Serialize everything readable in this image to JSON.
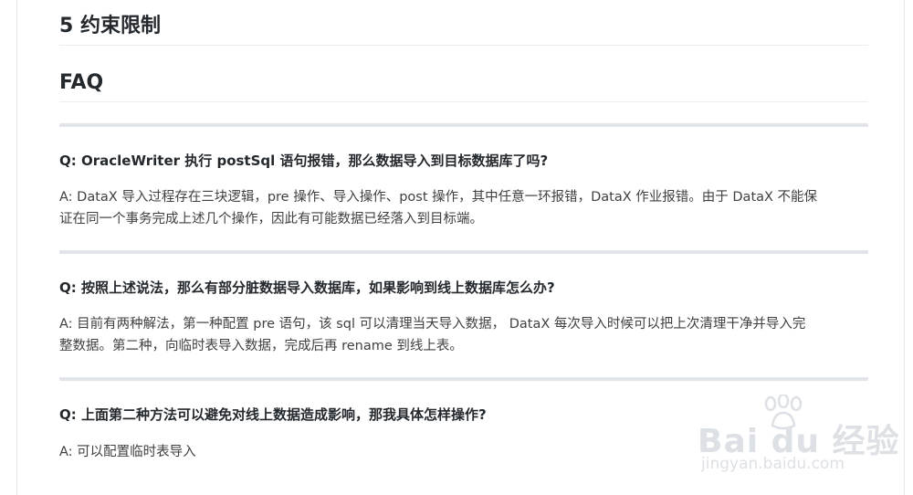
{
  "headings": {
    "constraints": "5 约束限制",
    "faq": "FAQ"
  },
  "faq": [
    {
      "question": "Q: OracleWriter 执行 postSql 语句报错，那么数据导入到目标数据库了吗?",
      "answer_lines": [
        "A: DataX 导入过程存在三块逻辑，pre 操作、导入操作、post 操作，其中任意一环报错，DataX 作业报错。由于 DataX 不能保",
        "证在同一个事务完成上述几个操作，因此有可能数据已经落入到目标端。"
      ]
    },
    {
      "question": "Q: 按照上述说法，那么有部分脏数据导入数据库，如果影响到线上数据库怎么办?",
      "answer_lines": [
        "A: 目前有两种解法，第一种配置 pre 语句，该 sql 可以清理当天导入数据， DataX 每次导入时候可以把上次清理干净并导入完",
        "整数据。第二种，向临时表导入数据，完成后再 rename 到线上表。"
      ]
    },
    {
      "question": "Q: 上面第二种方法可以避免对线上数据造成影响，那我具体怎样操作?",
      "answer_lines": [
        "A: 可以配置临时表导入"
      ]
    }
  ],
  "watermark": {
    "brand": "Bai du 经验",
    "url": "jingyan.baidu.com",
    "icon": "paw-icon"
  }
}
